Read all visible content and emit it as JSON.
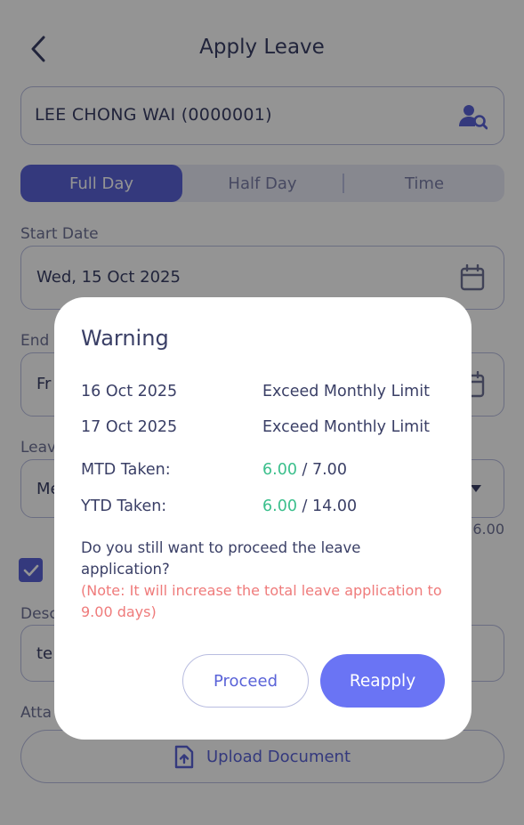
{
  "header": {
    "title": "Apply Leave",
    "back_icon": "chevron-left-icon"
  },
  "employee": {
    "value": "LEE CHONG WAI (0000001)",
    "icon": "user-search-icon"
  },
  "segments": [
    {
      "label": "Full Day",
      "active": true
    },
    {
      "label": "Half Day",
      "active": false
    },
    {
      "label": "Time",
      "active": false
    }
  ],
  "start_date": {
    "label": "Start Date",
    "value": "Wed, 15 Oct 2025",
    "icon": "calendar-icon"
  },
  "end_date": {
    "label": "End",
    "value": "Fr",
    "icon": "calendar-icon"
  },
  "leave_type": {
    "label": "Leav",
    "value": "Me",
    "balance_tail": "6.00",
    "icon": "dropdown-caret-icon"
  },
  "checkbox": {
    "checked": true
  },
  "description": {
    "label": "Desc",
    "value": "te"
  },
  "attachment": {
    "label": "Atta",
    "upload_label": "Upload Document",
    "icon": "file-upload-icon"
  },
  "modal": {
    "title": "Warning",
    "rows": [
      {
        "key": "16 Oct 2025",
        "value": "Exceed Monthly Limit"
      },
      {
        "key": "17 Oct 2025",
        "value": "Exceed Monthly Limit"
      }
    ],
    "mtd": {
      "label": "MTD Taken:",
      "taken": "6.00",
      "limit": " / 7.00"
    },
    "ytd": {
      "label": "YTD Taken:",
      "taken": "6.00",
      "limit": " / 14.00"
    },
    "question": "Do you still want to proceed the leave application?",
    "note": "(Note: It will increase the total leave application to 9.00 days)",
    "proceed_label": "Proceed",
    "reapply_label": "Reapply"
  },
  "colors": {
    "accent": "#5a63d8",
    "button": "#6a74f4",
    "success": "#3bbf8c",
    "danger": "#ef7b7b",
    "text": "#3a3f66"
  }
}
